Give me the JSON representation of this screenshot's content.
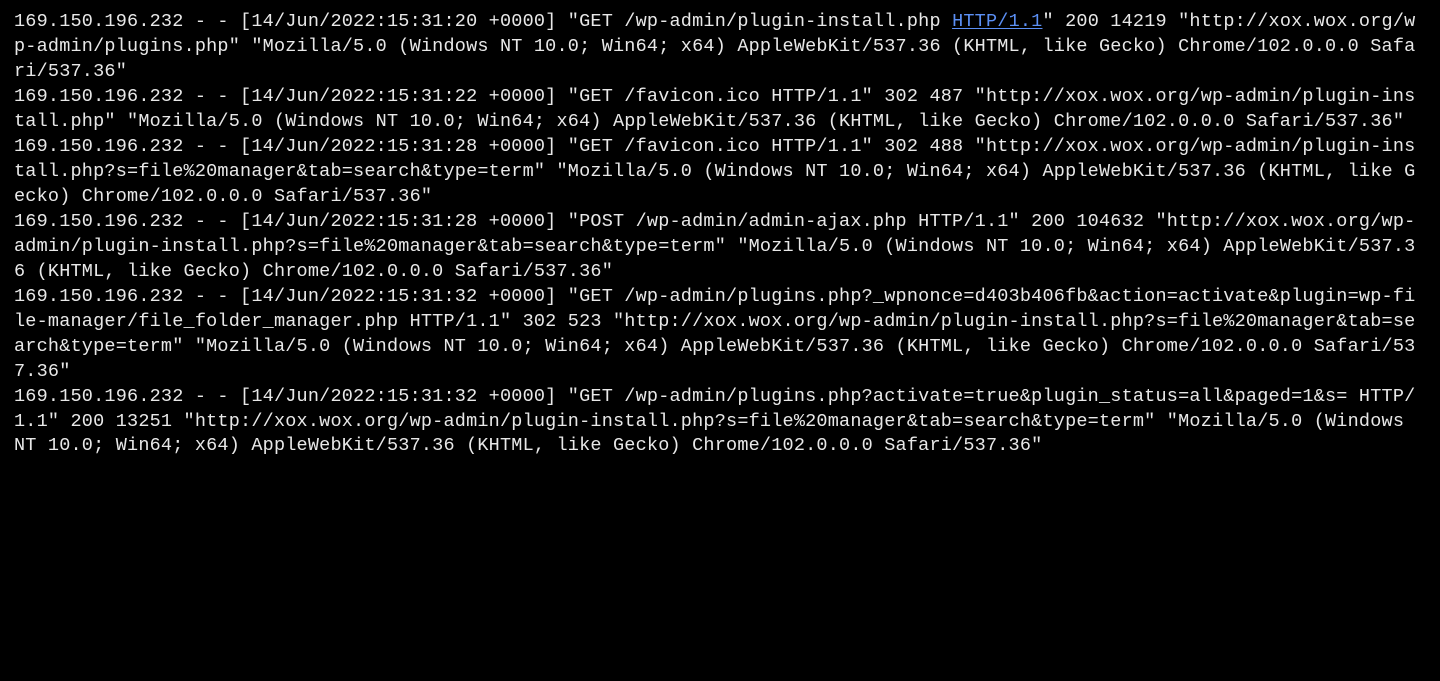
{
  "logs": [
    {
      "pre": "169.150.196.232 - - [14/Jun/2022:15:31:20 +0000] \"GET /wp-admin/plugin-install.php ",
      "link_text": "HTTP/1.1",
      "post": "\" 200 14219 \"http://xox.wox.org/wp-admin/plugins.php\" \"Mozilla/5.0 (Windows NT 10.0; Win64; x64) AppleWebKit/537.36 (KHTML, like Gecko) Chrome/102.0.0.0 Safari/537.36\""
    },
    {
      "pre": "169.150.196.232 - - [14/Jun/2022:15:31:22 +0000] \"GET /favicon.ico HTTP/1.1\" 302 487 \"http://xox.wox.org/wp-admin/plugin-install.php\" \"Mozilla/5.0 (Windows NT 10.0; Win64; x64) AppleWebKit/537.36 (KHTML, like Gecko) Chrome/102.0.0.0 Safari/537.36\"",
      "link_text": "",
      "post": ""
    },
    {
      "pre": "169.150.196.232 - - [14/Jun/2022:15:31:28 +0000] \"GET /favicon.ico HTTP/1.1\" 302 488 \"http://xox.wox.org/wp-admin/plugin-install.php?s=file%20manager&tab=search&type=term\" \"Mozilla/5.0 (Windows NT 10.0; Win64; x64) AppleWebKit/537.36 (KHTML, like Gecko) Chrome/102.0.0.0 Safari/537.36\"",
      "link_text": "",
      "post": ""
    },
    {
      "pre": "169.150.196.232 - - [14/Jun/2022:15:31:28 +0000] \"POST /wp-admin/admin-ajax.php HTTP/1.1\" 200 104632 \"http://xox.wox.org/wp-admin/plugin-install.php?s=file%20manager&tab=search&type=term\" \"Mozilla/5.0 (Windows NT 10.0; Win64; x64) AppleWebKit/537.36 (KHTML, like Gecko) Chrome/102.0.0.0 Safari/537.36\"",
      "link_text": "",
      "post": ""
    },
    {
      "pre": "169.150.196.232 - - [14/Jun/2022:15:31:32 +0000] \"GET /wp-admin/plugins.php?_wpnonce=d403b406fb&action=activate&plugin=wp-file-manager/file_folder_manager.php HTTP/1.1\" 302 523 \"http://xox.wox.org/wp-admin/plugin-install.php?s=file%20manager&tab=search&type=term\" \"Mozilla/5.0 (Windows NT 10.0; Win64; x64) AppleWebKit/537.36 (KHTML, like Gecko) Chrome/102.0.0.0 Safari/537.36\"",
      "link_text": "",
      "post": ""
    },
    {
      "pre": "169.150.196.232 - - [14/Jun/2022:15:31:32 +0000] \"GET /wp-admin/plugins.php?activate=true&plugin_status=all&paged=1&s= HTTP/1.1\" 200 13251 \"http://xox.wox.org/wp-admin/plugin-install.php?s=file%20manager&tab=search&type=term\" \"Mozilla/5.0 (Windows NT 10.0; Win64; x64) AppleWebKit/537.36 (KHTML, like Gecko) Chrome/102.0.0.0 Safari/537.36\"",
      "link_text": "",
      "post": ""
    }
  ]
}
